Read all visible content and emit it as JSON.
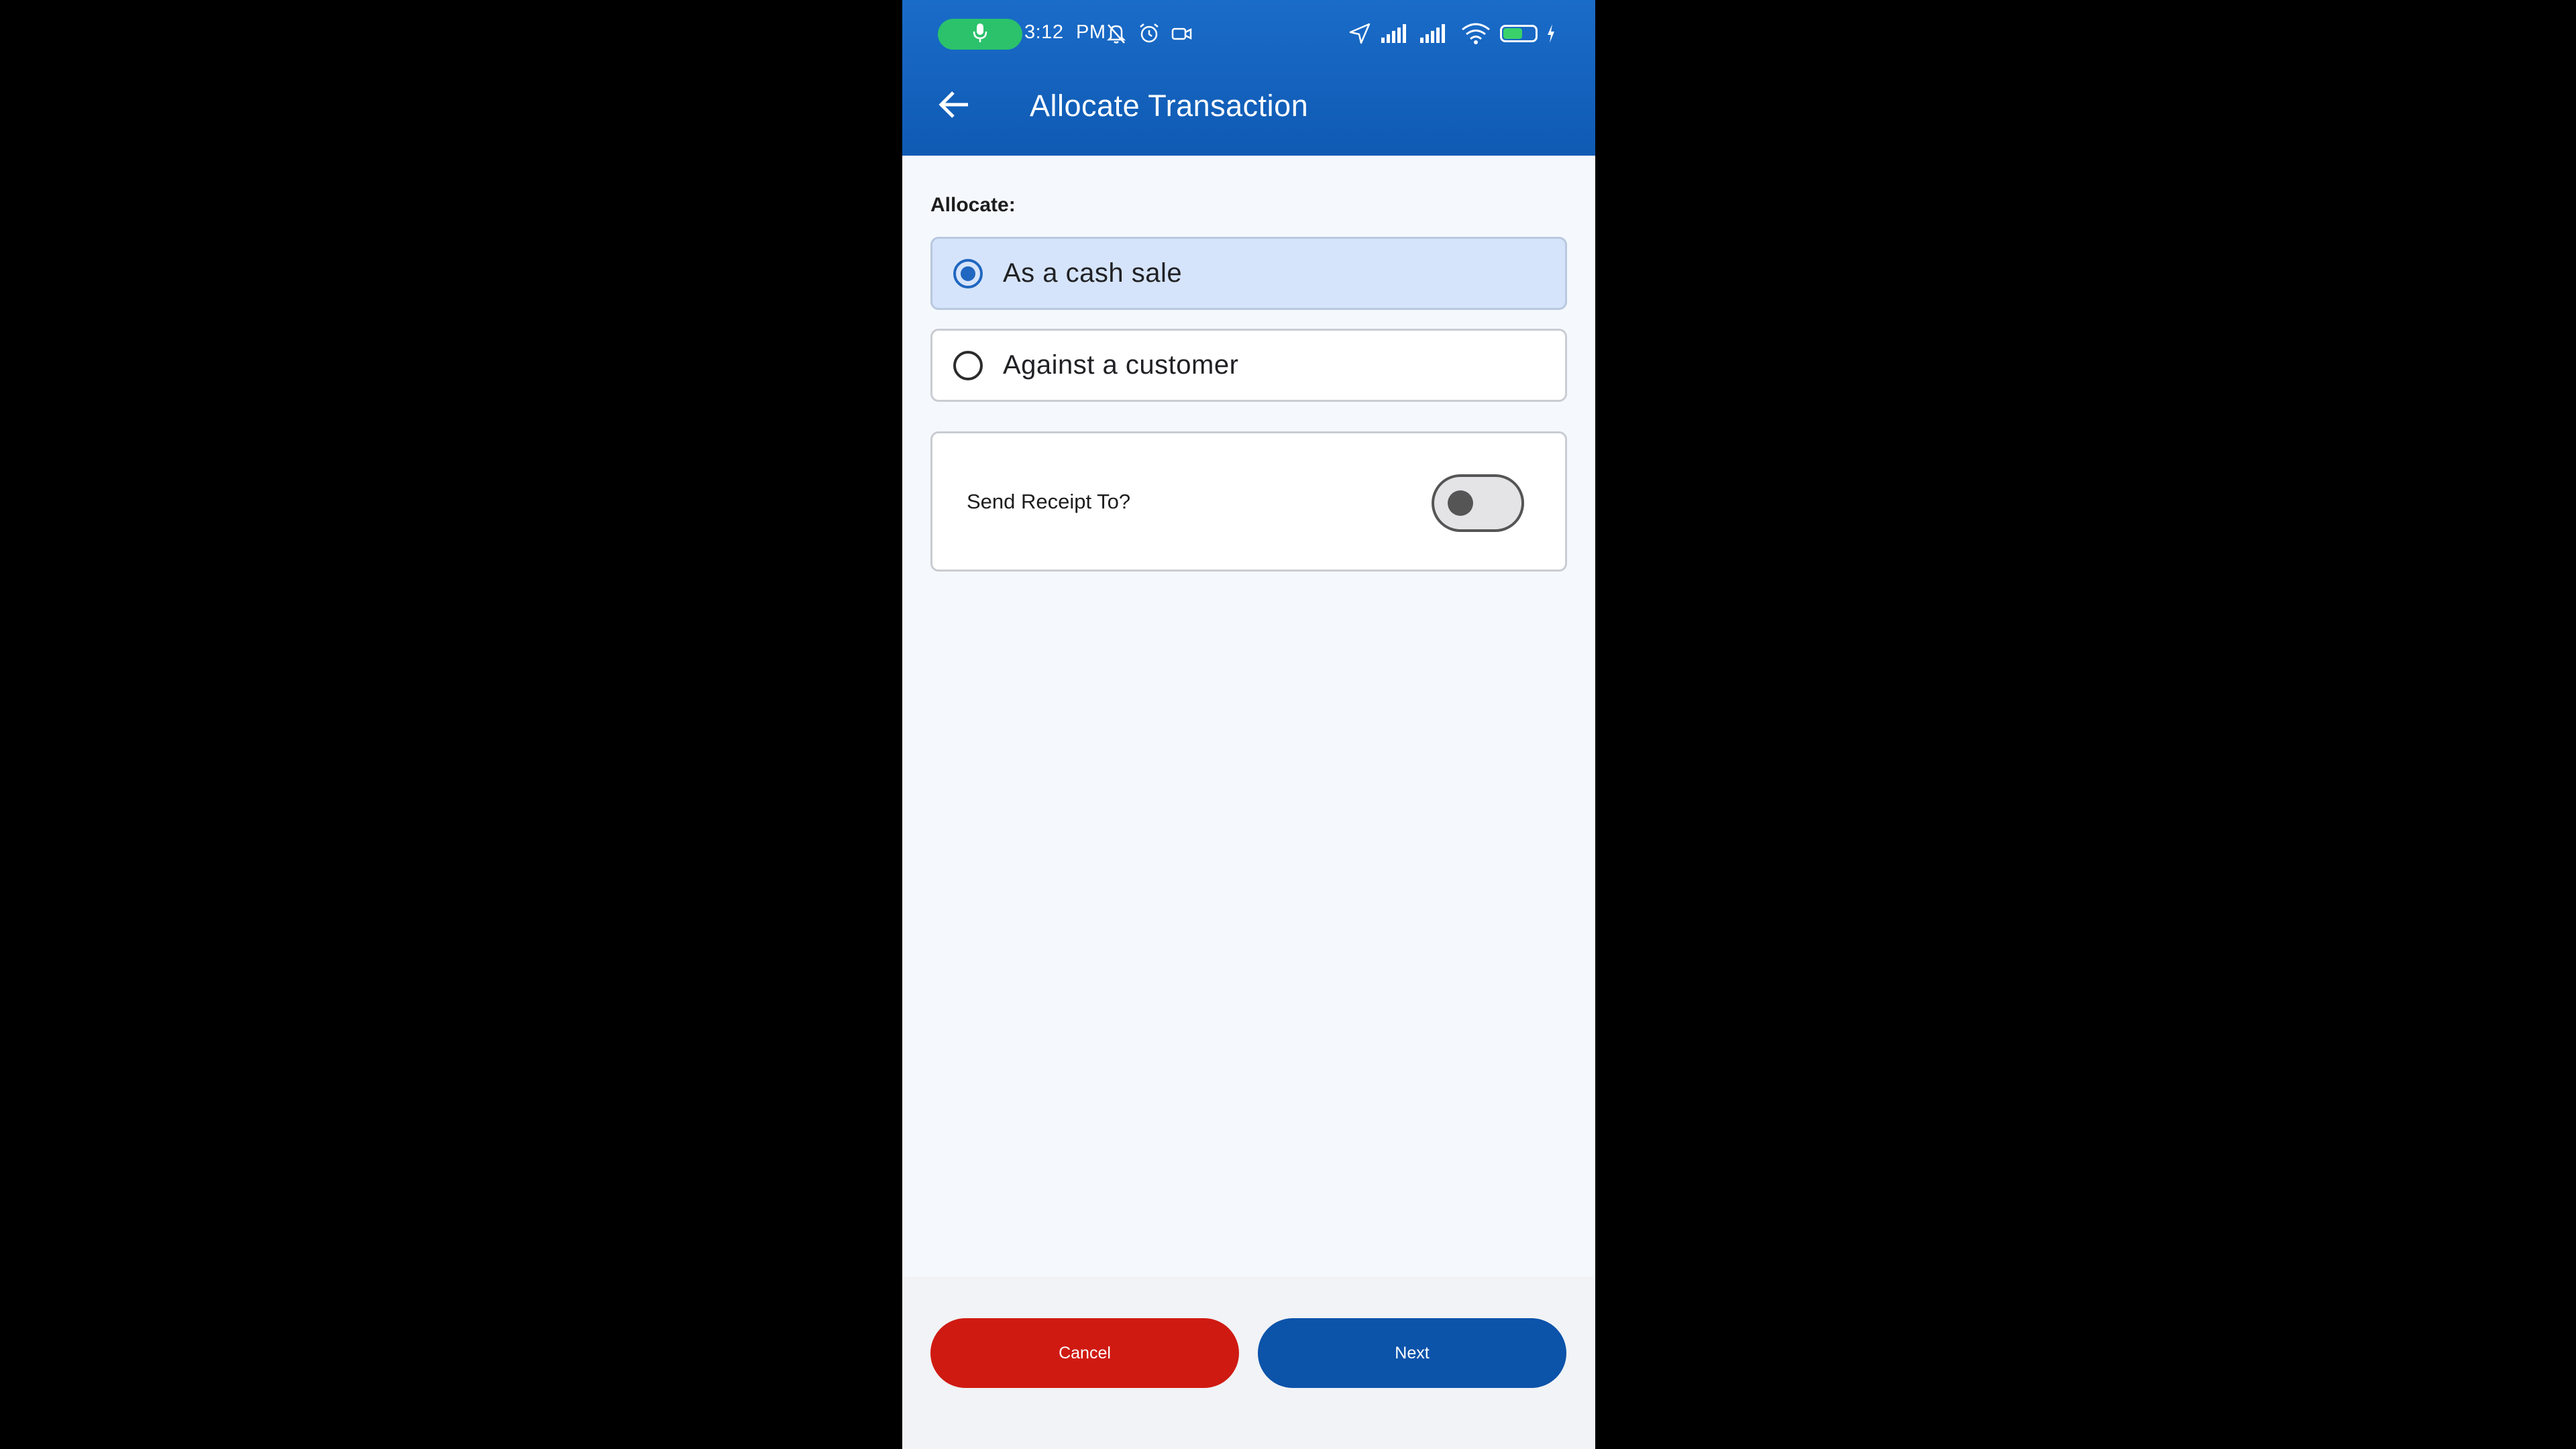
{
  "status_bar": {
    "time": "3:12",
    "ampm": "PM",
    "icons": [
      "mic-icon",
      "bell-off-icon",
      "alarm-icon",
      "video-record-icon",
      "location-arrow-icon",
      "signal-icon",
      "signal-icon",
      "wifi-icon",
      "battery-icon",
      "charging-icon"
    ],
    "battery_level": 0.6
  },
  "app_bar": {
    "back_icon": "arrow-left-icon",
    "title": "Allocate Transaction"
  },
  "form": {
    "allocate_label": "Allocate:",
    "options": [
      {
        "label": "As a cash sale",
        "selected": true
      },
      {
        "label": "Against a customer",
        "selected": false
      }
    ],
    "receipt": {
      "label": "Send Receipt To?",
      "toggle_on": false
    }
  },
  "actions": {
    "cancel_label": "Cancel",
    "next_label": "Next"
  },
  "colors": {
    "app_bar": "#1565c0",
    "selected_option_bg": "#d6e4fb",
    "radio_accent": "#1f67c0",
    "cancel": "#cf1a12",
    "next": "#0c53aa",
    "mic_pill": "#2bc26b"
  }
}
